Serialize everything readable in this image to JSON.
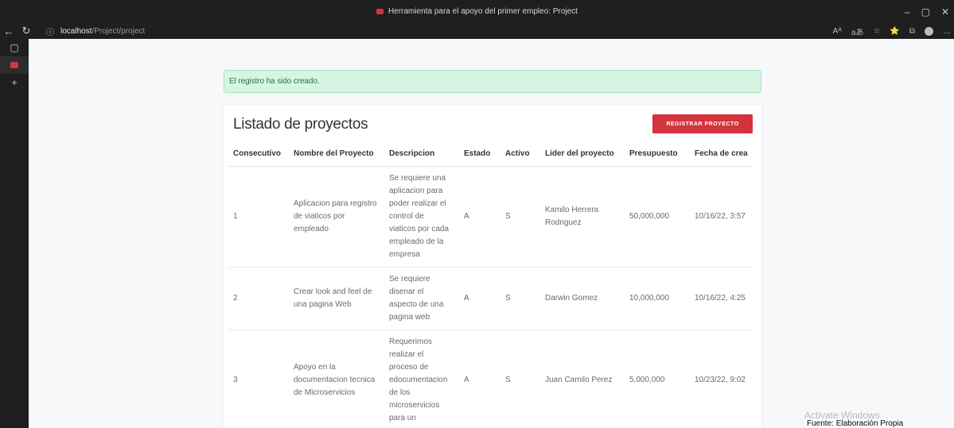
{
  "window": {
    "title": "Herramienta para el apoyo del primer empleo: Project",
    "controls": [
      "–",
      "▢",
      "✕"
    ]
  },
  "address_bar": {
    "host": "localhost",
    "path": "/Project/project",
    "right_icons": [
      "Aᴬ",
      "aあ",
      "☆",
      "⭐",
      "⧉",
      "…"
    ]
  },
  "sidebar": {
    "items": [
      "▢",
      "",
      "+"
    ]
  },
  "alert": {
    "text": "El registro ha sido creado."
  },
  "card": {
    "title": "Listado de proyectos",
    "register_button": "REGISTRAR PROYECTO"
  },
  "table": {
    "headers": [
      "Consecutivo",
      "Nombre del Proyecto",
      "Descripcion",
      "Estado",
      "Activo",
      "Lider del proyecto",
      "Presupuesto",
      "Fecha de crea"
    ],
    "rows": [
      {
        "consecutivo": "1",
        "nombre": "Aplicacion para registro de viaticos por empleado",
        "descripcion": "Se requiere una aplicacion para poder realizar el control de viaticos por cada empleado de la empresa",
        "estado": "A",
        "activo": "S",
        "lider": "Kamilo Herrera Rodriguez",
        "presupuesto": "50,000,000",
        "fecha": "10/16/22, 3:57"
      },
      {
        "consecutivo": "2",
        "nombre": "Crear look and feel de una pagina Web",
        "descripcion": "Se requiere disenar el aspecto de una pagina web",
        "estado": "A",
        "activo": "S",
        "lider": "Darwin Gomez",
        "presupuesto": "10,000,000",
        "fecha": "10/16/22, 4:25"
      },
      {
        "consecutivo": "3",
        "nombre": "Apoyo en la documentacion tecnica de Microservicios",
        "descripcion": "Requerimos realizar el proceso de edocumentacion de los microservicios para un",
        "estado": "A",
        "activo": "S",
        "lider": "Juan Camilo Perez",
        "presupuesto": "5,000,000",
        "fecha": "10/23/22, 9:02"
      }
    ]
  },
  "overlay": {
    "watermark": "Activate Windows",
    "source_note": "Fuente: Elaboración Propia"
  },
  "colors": {
    "accent": "#d3343b",
    "alert_bg": "#d7f5e3",
    "chrome": "#1f1f1f"
  }
}
